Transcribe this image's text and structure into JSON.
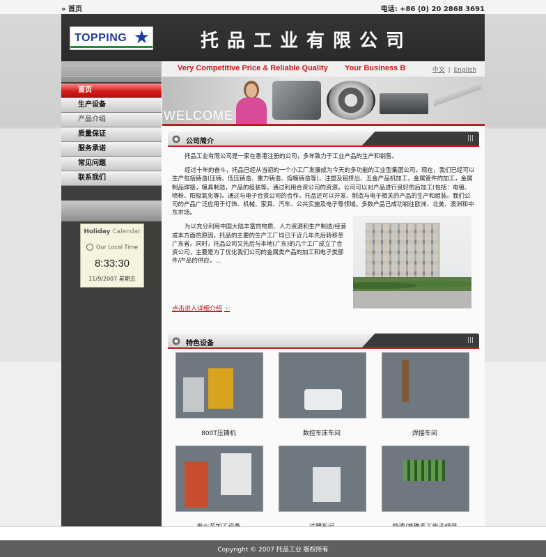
{
  "topbar": {
    "breadcrumb": "» 首页",
    "phone": "电话: +86 (0) 20 2868 3691"
  },
  "header": {
    "logo_text": "TOPPING",
    "company_name": "托品工业有限公司"
  },
  "banner": {
    "slogan": "Very Competitive Price & Reliable Quality        Your Business B",
    "lang_cn": "中文",
    "lang_sep": "|",
    "lang_en": "English",
    "welcome": "WELCOME"
  },
  "menu": {
    "items": [
      {
        "label": "首页"
      },
      {
        "label": "生产设备"
      },
      {
        "label": "产品介绍"
      },
      {
        "label": "质量保证"
      },
      {
        "label": "服务承诺"
      },
      {
        "label": "常见问题"
      },
      {
        "label": "联系我们"
      }
    ]
  },
  "calendar": {
    "title_bold": "Holiday",
    "title_rest": " Calendar",
    "local_label": "Our Local Time",
    "time": "8:33:30",
    "date": "11/9/2007 星期五"
  },
  "intro": {
    "title": "公司简介",
    "grip": "|||",
    "p1": "托品工业有限公司是一家在香港注册的公司，多年致力于工业产品的生产和销售。",
    "p2": "经过十年的奋斗，托品已经从当初的一个小工厂发展成为今天的多功能的工业型集团公司。现在，我们已经可以生产包括铸造(压铸、低压铸造、重力铸造、熔模铸造等)，注塑及铝挤出、五金产品机加工，金属管件的加工，金属制品焊接，模具制造，产品的组装等。通过利用合资公司的资源，公司可以对产品进行良好的后加工(包括：电镀、喷粉、阳极氧化等)。通过与电子合资公司的合作，托品还可以开发、制造与电子相关的产品的生产和组装。我们公司的产品广泛应用于灯饰、机械、家具、汽车、公共实施及电子等领域。多数产品已成功销往欧洲、北美、澳洲和中东市场。",
    "p3": "为以充分利用中国大陆丰富的物质、人力资源和生产制造/经营成本方面的原因，托品的主要的生产工厂均已于近几年先后转移至广东省。同时，托品公司又先后与本地(广东)的几个工厂成立了合资公司，主要是为了优化我们公司的金属类产品的加工和电子类部件/产品的供应。...",
    "more_link": "点击进入详细介绍"
  },
  "equipment": {
    "title": "特色设备",
    "grip": "|||",
    "items": [
      {
        "caption": "800T压铸机"
      },
      {
        "caption": "数控车床车间"
      },
      {
        "caption": "焊接车间"
      },
      {
        "caption": "电火花加工设备"
      },
      {
        "caption": "注塑车间"
      },
      {
        "caption": "快速/准确手工电子组装"
      }
    ]
  },
  "footer": {
    "copyright": "Copyright © 2007 托品工业 版权所有"
  }
}
